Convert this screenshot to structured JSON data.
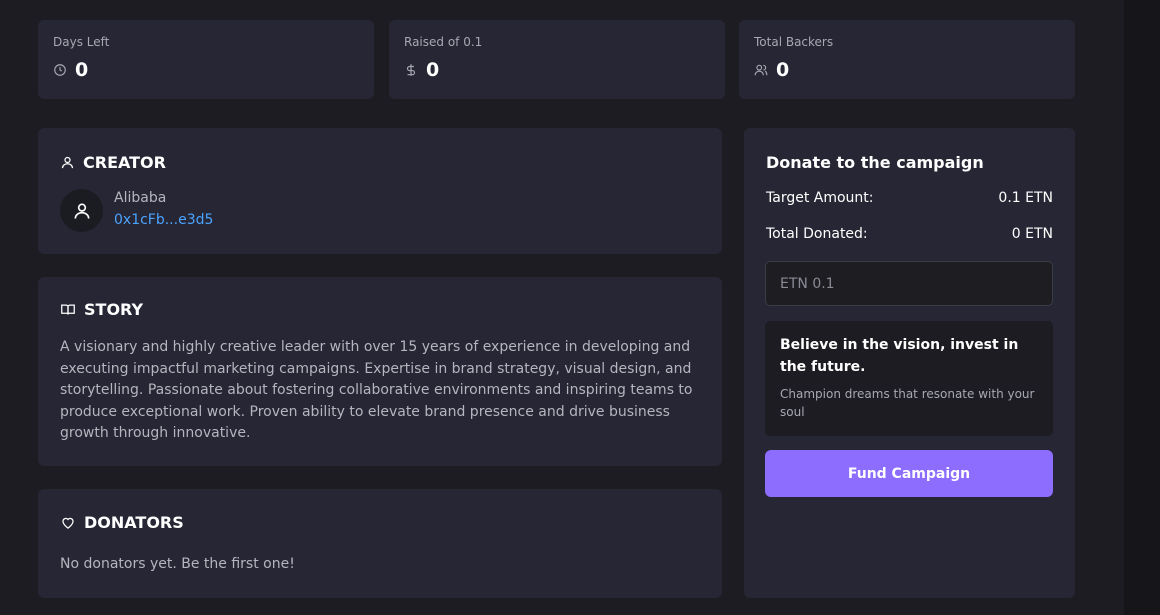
{
  "stats": [
    {
      "label": "Days Left",
      "value": "0",
      "icon": "clock-icon"
    },
    {
      "label": "Raised of 0.1",
      "value": "0",
      "icon": "dollar-icon"
    },
    {
      "label": "Total Backers",
      "value": "0",
      "icon": "users-icon"
    }
  ],
  "creator": {
    "title": "CREATOR",
    "name": "Alibaba",
    "address": "0x1cFb...e3d5"
  },
  "story": {
    "title": "STORY",
    "text": "A visionary and highly creative leader with over 15 years of experience in developing and executing impactful marketing campaigns. Expertise in brand strategy, visual design, and storytelling. Passionate about fostering collaborative environments and inspiring teams to produce exceptional work. Proven ability to elevate brand presence and drive business growth through innovative."
  },
  "donators": {
    "title": "DONATORS",
    "empty_text": "No donators yet. Be the first one!"
  },
  "donate": {
    "title": "Donate to the campaign",
    "target_label": "Target Amount:",
    "target_value": "0.1 ETN",
    "donated_label": "Total Donated:",
    "donated_value": "0 ETN",
    "amount_placeholder": "ETN 0.1",
    "promo_heading": "Believe in the vision, invest in the future.",
    "promo_subtext": "Champion dreams that resonate with your soul",
    "fund_button": "Fund Campaign"
  },
  "colors": {
    "background": "#1c1c22",
    "card": "#262634",
    "accent": "#8c6dfd",
    "link": "#4aa3ff"
  }
}
